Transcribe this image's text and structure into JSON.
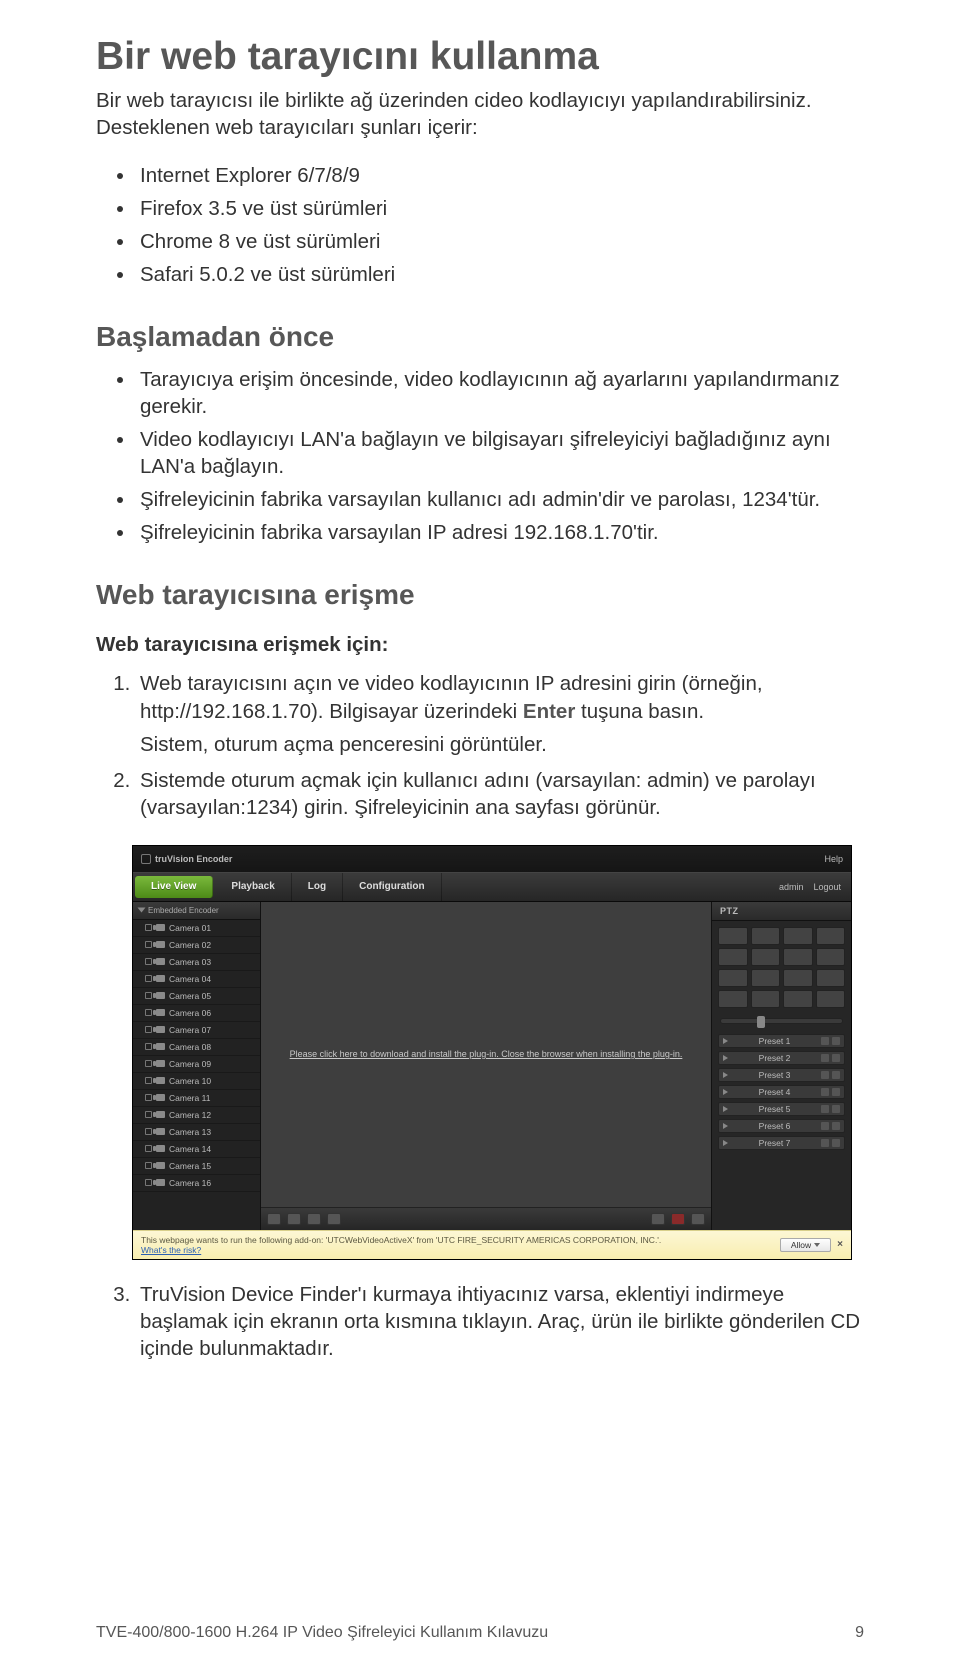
{
  "title": "Bir web tarayıcını kullanma",
  "intro": "Bir web tarayıcısı ile birlikte ağ üzerinden cideo kodlayıcıyı yapılandırabilirsiniz. Desteklenen web tarayıcıları şunları içerir:",
  "browsers": [
    "Internet Explorer 6/7/8/9",
    "Firefox 3.5 ve üst sürümleri",
    "Chrome 8 ve üst sürümleri",
    "Safari 5.0.2 ve üst sürümleri"
  ],
  "before_heading": "Başlamadan önce",
  "before_bullets": [
    "Tarayıcıya erişim öncesinde, video kodlayıcının ağ ayarlarını yapılandırmanız gerekir.",
    "Video kodlayıcıyı LAN'a bağlayın ve bilgisayarı şifreleyiciyi bağladığınız aynı LAN'a bağlayın.",
    "Şifreleyicinin fabrika varsayılan kullanıcı adı admin'dir ve parolası, 1234'tür.",
    "Şifreleyicinin fabrika varsayılan IP adresi 192.168.1.70'tir."
  ],
  "access_heading": "Web tarayıcısına erişme",
  "access_subhead": "Web tarayıcısına erişmek için:",
  "steps_1a": "Web tarayıcısını açın ve video kodlayıcının IP adresini girin (örneğin, http://192.168.1.70). Bilgisayar üzerindeki ",
  "steps_1_enter": "Enter",
  "steps_1b": " tuşuna basın.",
  "steps_1_sub": "Sistem, oturum açma penceresini görüntüler.",
  "steps_2": "Sistemde oturum açmak için kullanıcı adını (varsayılan: admin) ve parolayı (varsayılan:1234) girin. Şifreleyicinin ana sayfası görünür.",
  "steps_3": "TruVision Device Finder'ı kurmaya ihtiyacınız varsa, eklentiyi indirmeye başlamak için ekranın orta kısmına tıklayın. Araç, ürün ile birlikte gönderilen CD içinde bulunmaktadır.",
  "footer_left": "TVE-400/800-1600 H.264 IP Video Şifreleyici Kullanım Kılavuzu",
  "footer_right": "9",
  "app": {
    "brand": "truVision Encoder",
    "help": "Help",
    "tabs": {
      "live": "Live View",
      "playback": "Playback",
      "log": "Log",
      "config": "Configuration"
    },
    "user_label": "admin",
    "logout": "Logout",
    "side_title": "Embedded Encoder",
    "cameras": [
      "Camera 01",
      "Camera 02",
      "Camera 03",
      "Camera 04",
      "Camera 05",
      "Camera 06",
      "Camera 07",
      "Camera 08",
      "Camera 09",
      "Camera 10",
      "Camera 11",
      "Camera 12",
      "Camera 13",
      "Camera 14",
      "Camera 15",
      "Camera 16"
    ],
    "view_msg": "Please click here to download and install the plug-in. Close the browser when installing the plug-in.",
    "ptz_title": "PTZ",
    "presets": [
      "Preset 1",
      "Preset 2",
      "Preset 3",
      "Preset 4",
      "Preset 5",
      "Preset 6",
      "Preset 7"
    ],
    "ie_msg": "This webpage wants to run the following add-on: 'UTCWebVideoActiveX' from 'UTC FIRE_SECURITY AMERICAS CORPORATION, INC.'.",
    "ie_risk": "What's the risk?",
    "ie_allow": "Allow"
  }
}
